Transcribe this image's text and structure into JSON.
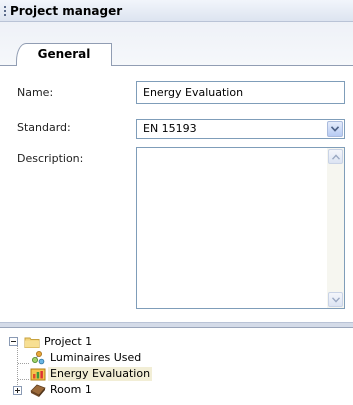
{
  "panel": {
    "title": "Project manager"
  },
  "tabs": [
    {
      "label": "General",
      "active": true
    }
  ],
  "form": {
    "name_label": "Name:",
    "name_value": "Energy Evaluation",
    "standard_label": "Standard:",
    "standard_value": "EN 15193",
    "description_label": "Description:",
    "description_value": ""
  },
  "tree": {
    "items": [
      {
        "label": "Project 1",
        "icon": "folder-icon",
        "expander": "minus"
      },
      {
        "label": "Luminaires Used",
        "icon": "luminaires-icon"
      },
      {
        "label": "Energy Evaluation",
        "icon": "energy-evaluation-icon",
        "selected": true
      },
      {
        "label": "Room 1",
        "icon": "room-icon",
        "expander": "plus"
      }
    ]
  },
  "colors": {
    "field_border": "#7f9db9",
    "selection": "#f2eed6",
    "title_bar": "#dde4f0"
  }
}
